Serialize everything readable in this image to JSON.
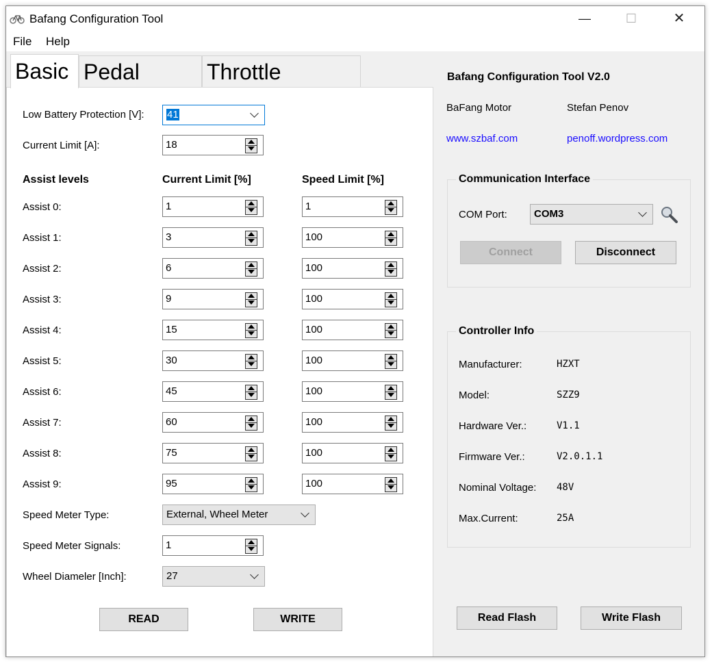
{
  "window": {
    "title": "Bafang Configuration Tool",
    "minimize": "—",
    "maximize": "☐",
    "close": "✕"
  },
  "menu": [
    "File",
    "Help"
  ],
  "tabs": [
    "Basic",
    "Pedal Assist",
    "Throttle Handle"
  ],
  "basic": {
    "low_battery_label": "Low Battery Protection [V]:",
    "low_battery_value": "41",
    "current_limit_label": "Current Limit [A]:",
    "current_limit_value": "18",
    "assist_levels_header": "Assist levels",
    "current_limit_pct_header": "Current Limit [%]",
    "speed_limit_pct_header": "Speed Limit [%]",
    "assists": [
      {
        "label": "Assist 0:",
        "current": "1",
        "speed": "1"
      },
      {
        "label": "Assist 1:",
        "current": "3",
        "speed": "100"
      },
      {
        "label": "Assist 2:",
        "current": "6",
        "speed": "100"
      },
      {
        "label": "Assist 3:",
        "current": "9",
        "speed": "100"
      },
      {
        "label": "Assist 4:",
        "current": "15",
        "speed": "100"
      },
      {
        "label": "Assist 5:",
        "current": "30",
        "speed": "100"
      },
      {
        "label": "Assist 6:",
        "current": "45",
        "speed": "100"
      },
      {
        "label": "Assist 7:",
        "current": "60",
        "speed": "100"
      },
      {
        "label": "Assist 8:",
        "current": "75",
        "speed": "100"
      },
      {
        "label": "Assist 9:",
        "current": "95",
        "speed": "100"
      }
    ],
    "speed_meter_type_label": "Speed Meter Type:",
    "speed_meter_type_value": "External, Wheel Meter",
    "speed_meter_signals_label": "Speed Meter Signals:",
    "speed_meter_signals_value": "1",
    "wheel_diameter_label": "Wheel Diameler [Inch]:",
    "wheel_diameter_value": "27",
    "read_button": "READ",
    "write_button": "WRITE"
  },
  "about": {
    "title": "Bafang Configuration Tool V2.0",
    "col1_name": "BaFang Motor",
    "col2_name": "Stefan Penov",
    "col1_link": "www.szbaf.com",
    "col2_link": "penoff.wordpress.com"
  },
  "comm": {
    "title": "Communication Interface",
    "port_label": "COM Port:",
    "port_value": "COM3",
    "connect": "Connect",
    "disconnect": "Disconnect"
  },
  "controller": {
    "title": "Controller Info",
    "rows": [
      {
        "label": "Manufacturer:",
        "value": "HZXT"
      },
      {
        "label": "Model:",
        "value": "SZZ9"
      },
      {
        "label": "Hardware Ver.:",
        "value": "V1.1"
      },
      {
        "label": "Firmware Ver.:",
        "value": "V2.0.1.1"
      },
      {
        "label": "Nominal Voltage:",
        "value": "48V"
      },
      {
        "label": "Max.Current:",
        "value": "25A"
      }
    ]
  },
  "flash": {
    "read": "Read Flash",
    "write": "Write Flash"
  }
}
